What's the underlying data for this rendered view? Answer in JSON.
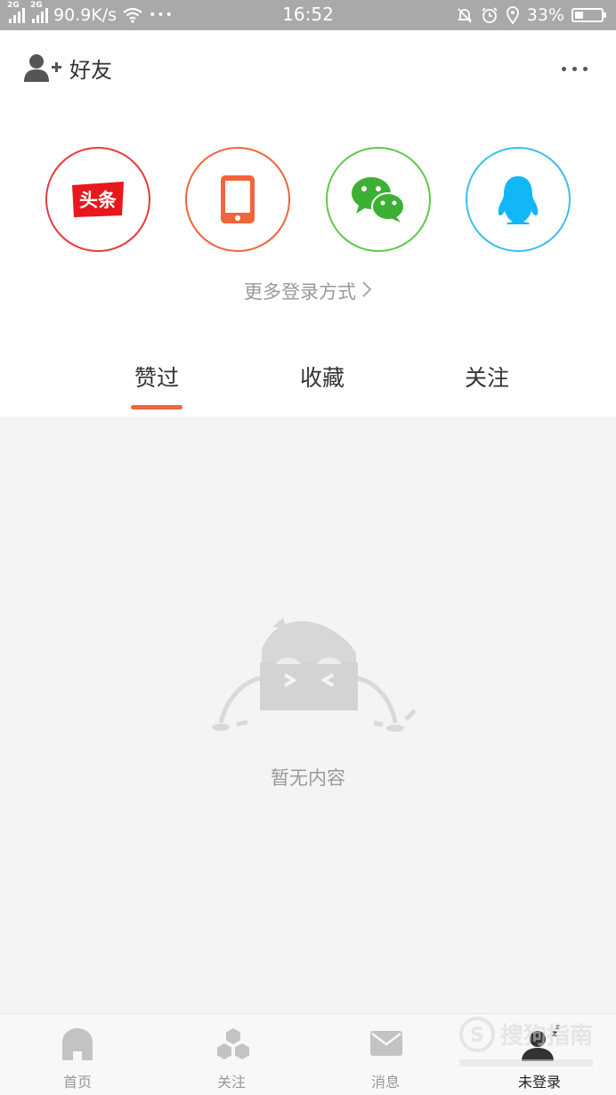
{
  "status_bar": {
    "net1": "2G",
    "net2": "2G",
    "speed": "90.9K/s",
    "dots": "•••",
    "time": "16:52",
    "battery": "33%",
    "battery_level": 0.33
  },
  "header": {
    "friends_label": "好友"
  },
  "login": {
    "more_label": "更多登录方式",
    "toutiao_text": "头条",
    "colors": {
      "toutiao": "#e63c3c",
      "phone": "#f0653a",
      "wechat": "#5fc84a",
      "qq": "#3dbfef"
    }
  },
  "tabs": [
    {
      "label": "赞过",
      "active": true
    },
    {
      "label": "收藏",
      "active": false
    },
    {
      "label": "关注",
      "active": false
    }
  ],
  "empty": {
    "message": "暂无内容"
  },
  "bottom_nav": [
    {
      "label": "首页",
      "icon": "home-icon"
    },
    {
      "label": "关注",
      "icon": "follow-icon"
    },
    {
      "label": "消息",
      "icon": "message-icon"
    },
    {
      "label": "未登录",
      "icon": "user-sleep-icon",
      "active": true
    }
  ],
  "watermark": {
    "text": "搜狗指南"
  },
  "accent_color": "#f0653a"
}
